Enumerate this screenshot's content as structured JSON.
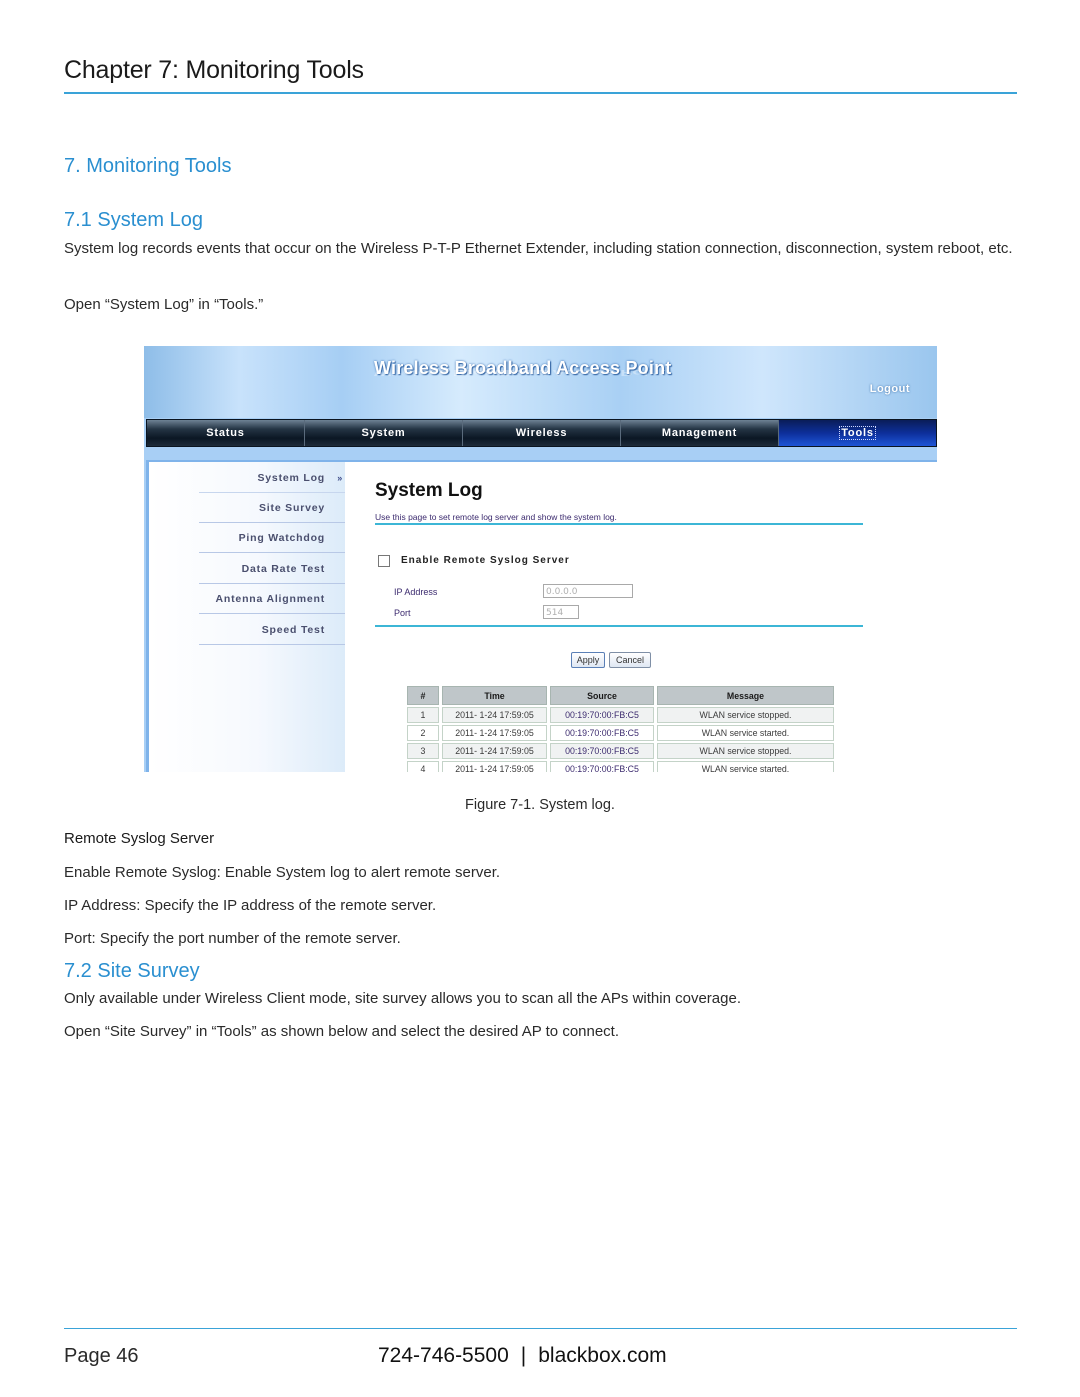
{
  "header": {
    "chapter_title": "Chapter 7: Monitoring Tools"
  },
  "section": {
    "title": "7. Monitoring Tools",
    "sub1": {
      "title": "7.1 System Log",
      "paragraph": "System log records events that occur on the Wireless P-T-P Ethernet Extender, including station connection, disconnection, system reboot, etc.",
      "instruction": "Open “System Log” in “Tools.”"
    },
    "figure": {
      "banner_title": "Wireless Broadband Access Point",
      "logout_label": "Logout",
      "nav": [
        {
          "label": "Status",
          "active": false
        },
        {
          "label": "System",
          "active": false
        },
        {
          "label": "Wireless",
          "active": false
        },
        {
          "label": "Management",
          "active": false
        },
        {
          "label": "Tools",
          "active": true
        }
      ],
      "side_menu": [
        {
          "label": "System Log",
          "active": true
        },
        {
          "label": "Site Survey",
          "active": false
        },
        {
          "label": "Ping Watchdog",
          "active": false
        },
        {
          "label": "Data Rate Test",
          "active": false
        },
        {
          "label": "Antenna Alignment",
          "active": false
        },
        {
          "label": "Speed Test",
          "active": false
        }
      ],
      "active_marker": "»",
      "page_title": "System Log",
      "page_desc": "Use this page to set remote log server and show the system log.",
      "enable_label": "Enable Remote Syslog Server",
      "enable_checked": false,
      "ip_label": "IP Address",
      "ip_value": "0.0.0.0",
      "port_label": "Port",
      "port_value": "514",
      "apply_label": "Apply",
      "cancel_label": "Cancel",
      "table": {
        "headers": [
          "#",
          "Time",
          "Source",
          "Message"
        ],
        "rows": [
          [
            "1",
            "2011- 1-24 17:59:05",
            "00:19:70:00:FB:C5",
            "WLAN service stopped."
          ],
          [
            "2",
            "2011- 1-24 17:59:05",
            "00:19:70:00:FB:C5",
            "WLAN service started."
          ],
          [
            "3",
            "2011- 1-24 17:59:05",
            "00:19:70:00:FB:C5",
            "WLAN service stopped."
          ],
          [
            "4",
            "2011- 1-24 17:59:05",
            "00:19:70:00:FB:C5",
            "WLAN service started."
          ]
        ]
      },
      "caption": "Figure 7-1. System log."
    },
    "remote_syslog": {
      "heading": "Remote Syslog Server",
      "items": [
        "Enable Remote Syslog: Enable System log to alert remote server.",
        "IP Address: Specify the IP address of the remote server.",
        "Port: Specify the port number of the remote server."
      ]
    },
    "sub2": {
      "title": "7.2 Site Survey",
      "paragraph": "Only available under Wireless Client mode, site survey allows you to scan all the APs within coverage.",
      "instruction": "Open “Site Survey” in “Tools” as shown below and select the desired AP to connect."
    }
  },
  "footer": {
    "page": "Page 46",
    "phone": "724-746-5500",
    "separator": "|",
    "website": "blackbox.com"
  },
  "colors": {
    "accent": "#2a8fd0",
    "rule": "#3aa3d8"
  }
}
